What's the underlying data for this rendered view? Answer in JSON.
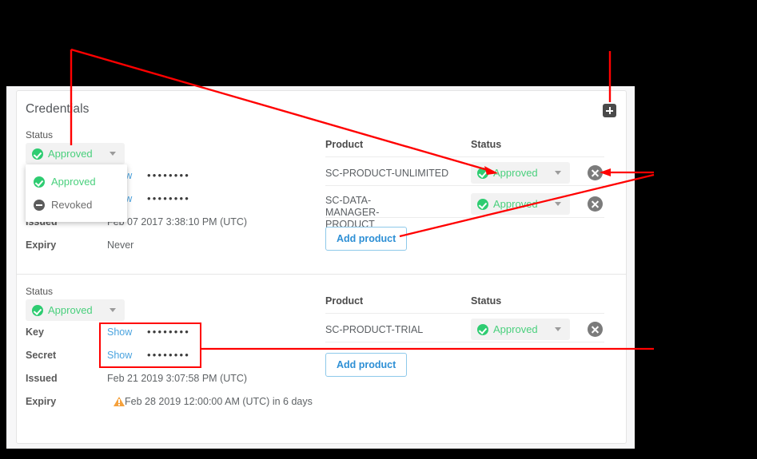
{
  "panel": {
    "title": "Credentials",
    "add_button_icon": "plus-icon"
  },
  "labels": {
    "status": "Status",
    "key": "Key",
    "secret": "Secret",
    "issued": "Issued",
    "expiry": "Expiry",
    "product_column": "Product",
    "status_column": "Status",
    "show_link": "Show",
    "masked_value": "••••••••",
    "add_product": "Add product",
    "remove_icon": "remove-circle-icon",
    "warning_icon": "warning-triangle-icon",
    "caret_icon": "chevron-down-icon",
    "check_icon": "check-circle-icon",
    "revoked_icon": "minus-circle-icon"
  },
  "status_options": [
    {
      "label": "Approved",
      "icon": "check-circle-icon",
      "color": "#4ad07d"
    },
    {
      "label": "Revoked",
      "icon": "minus-circle-icon",
      "color": "#6d6d6d"
    }
  ],
  "colors": {
    "approved_green": "#2ecc71",
    "link_blue": "#4aa3df",
    "add_product_blue": "#2d8fd5",
    "warning_orange": "#f5a13c",
    "annotation_red": "#ff0000",
    "page_background": "#000000",
    "panel_background": "#f7f7f8",
    "card_background": "#ffffff"
  },
  "credentials": [
    {
      "status": "Approved",
      "dropdown_open": true,
      "key": "••••••••",
      "secret": "••••••••",
      "issued": "Feb 07 2017 3:38:10 PM (UTC)",
      "expiry": "Never",
      "expiry_warning": false,
      "products": [
        {
          "name": "SC-PRODUCT-UNLIMITED",
          "status": "Approved"
        },
        {
          "name": "SC-DATA-MANAGER-PRODUCT",
          "status": "Approved"
        }
      ]
    },
    {
      "status": "Approved",
      "dropdown_open": false,
      "key": "••••••••",
      "secret": "••••••••",
      "issued": "Feb 21 2019 3:07:58 PM (UTC)",
      "expiry": "Feb 28 2019 12:00:00 AM (UTC) in 6 days",
      "expiry_warning": true,
      "products": [
        {
          "name": "SC-PRODUCT-TRIAL",
          "status": "Approved"
        }
      ]
    }
  ]
}
